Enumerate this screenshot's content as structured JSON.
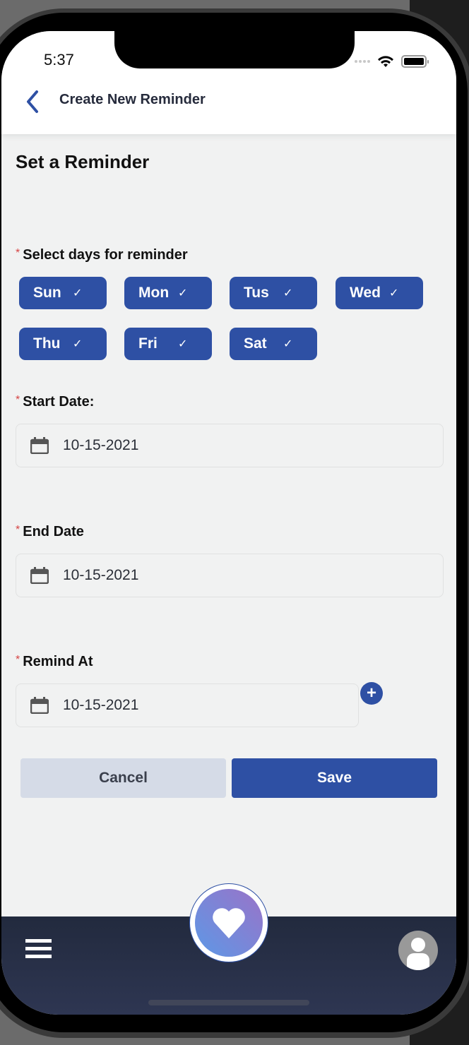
{
  "status_bar": {
    "time": "5:37"
  },
  "header": {
    "title": "Create New Reminder",
    "back_icon": "chevron-left-icon"
  },
  "page": {
    "title": "Set a Reminder",
    "required_marker": "*"
  },
  "days": {
    "label": "Select days for reminder",
    "items": [
      {
        "label": "Sun",
        "selected": true
      },
      {
        "label": "Mon",
        "selected": true
      },
      {
        "label": "Tus",
        "selected": true
      },
      {
        "label": "Wed",
        "selected": true
      },
      {
        "label": "Thu",
        "selected": true
      },
      {
        "label": "Fri",
        "selected": true
      },
      {
        "label": "Sat",
        "selected": true
      }
    ],
    "check_glyph": "✓"
  },
  "start_date": {
    "label": "Start Date:",
    "value": "10-15-2021",
    "icon": "calendar-icon"
  },
  "end_date": {
    "label": "End Date",
    "value": "10-15-2021",
    "icon": "calendar-icon"
  },
  "remind_at": {
    "label": "Remind At",
    "value": "10-15-2021",
    "icon": "calendar-icon",
    "add_glyph": "+"
  },
  "actions": {
    "cancel_label": "Cancel",
    "save_label": "Save"
  },
  "bottom_nav": {
    "menu_icon": "hamburger-menu-icon",
    "center_icon": "heart-icon",
    "profile_icon": "user-avatar-icon"
  },
  "colors": {
    "primary": "#2e50a4",
    "cancel_bg": "#d5dbe7",
    "nav_bg": "#262e45",
    "required": "#d64545",
    "page_bg": "#f1f2f2"
  }
}
